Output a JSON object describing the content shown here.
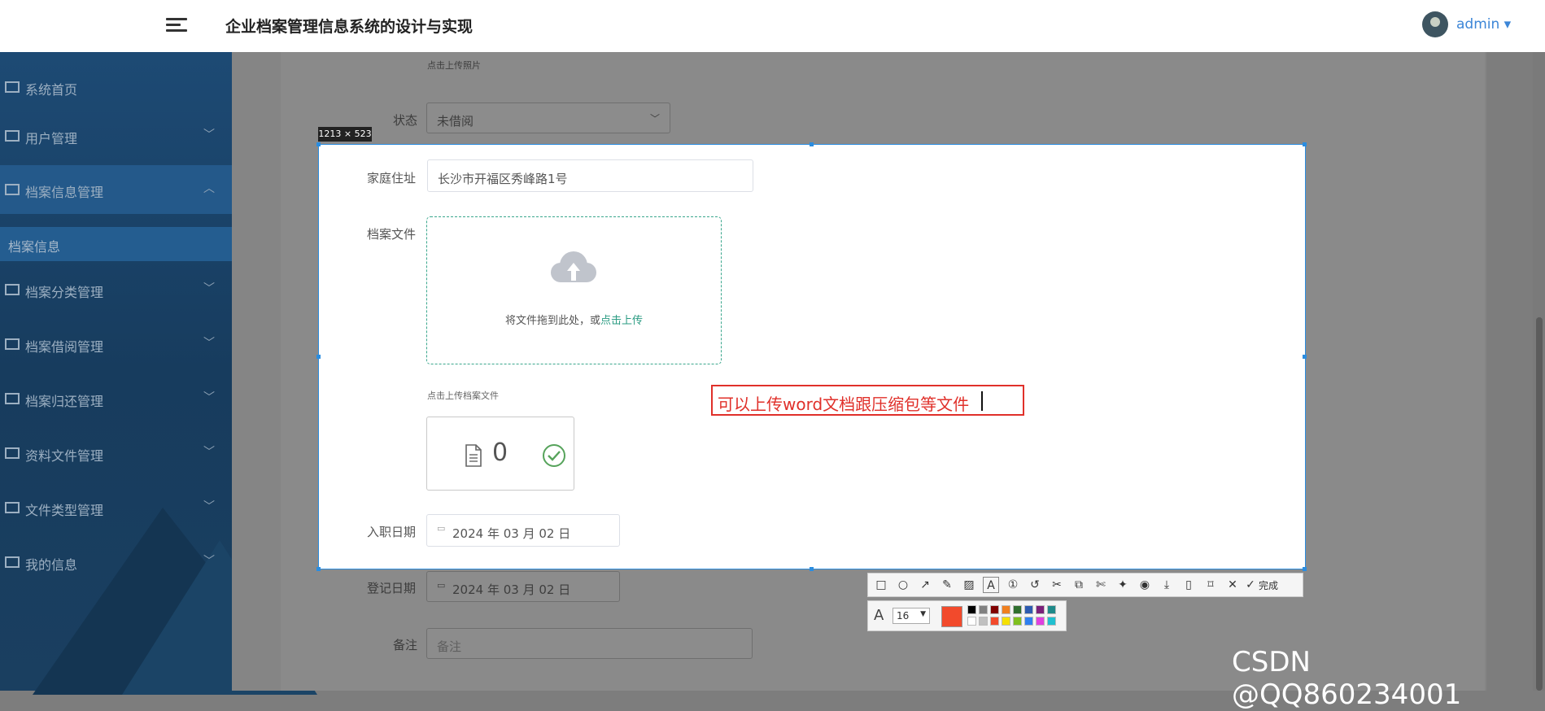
{
  "header": {
    "title": "企业档案管理信息系统的设计与实现",
    "user": "admin ▾"
  },
  "sidebar": {
    "items": [
      {
        "label": "系统首页",
        "icon": "home-icon",
        "arrow": ""
      },
      {
        "label": "用户管理",
        "icon": "list-icon",
        "arrow": "﹀"
      },
      {
        "label": "档案信息管理",
        "icon": "grid-icon",
        "arrow": "︿"
      },
      {
        "label": "档案分类管理",
        "icon": "sliders-icon",
        "arrow": "﹀"
      },
      {
        "label": "档案借阅管理",
        "icon": "printer-icon",
        "arrow": "﹀"
      },
      {
        "label": "档案归还管理",
        "icon": "grid-icon",
        "arrow": "﹀"
      },
      {
        "label": "资料文件管理",
        "icon": "grid-icon",
        "arrow": "﹀"
      },
      {
        "label": "文件类型管理",
        "icon": "list-icon",
        "arrow": "﹀"
      },
      {
        "label": "我的信息",
        "icon": "wallet-icon",
        "arrow": "﹀"
      }
    ],
    "sub_item": "档案信息"
  },
  "form": {
    "photo_tip": "点击上传照片",
    "status_label": "状态",
    "status_value": "未借阅",
    "address_label": "家庭住址",
    "address_value": "长沙市开福区秀峰路1号",
    "file_label": "档案文件",
    "upload_text": "将文件拖到此处，或",
    "upload_link": "点击上传",
    "file_tip": "点击上传档案文件",
    "file_count": "0",
    "hire_label": "入职日期",
    "hire_value": "2024 年 03 月 02 日",
    "reg_label": "登记日期",
    "reg_value": "2024 年 03 月 02 日",
    "remark_label": "备注",
    "remark_placeholder": "备注"
  },
  "capture": {
    "size_tag": "1213 × 523",
    "annotation": "可以上传word文档跟压缩包等文件",
    "done_label": "完成",
    "font_size": "16",
    "current_color": "#f24a2c",
    "palette_top": [
      "#000000",
      "#808080",
      "#800000",
      "#f08020",
      "#2f6f2f",
      "#2d5bb0",
      "#7a1f7a",
      "#1f8a8a"
    ],
    "palette_bottom": [
      "#ffffff",
      "#c0c0c0",
      "#f24a2c",
      "#f5e000",
      "#80c020",
      "#3080f0",
      "#e040e0",
      "#20c0d0"
    ]
  },
  "watermark": "CSDN @QQ860234001"
}
